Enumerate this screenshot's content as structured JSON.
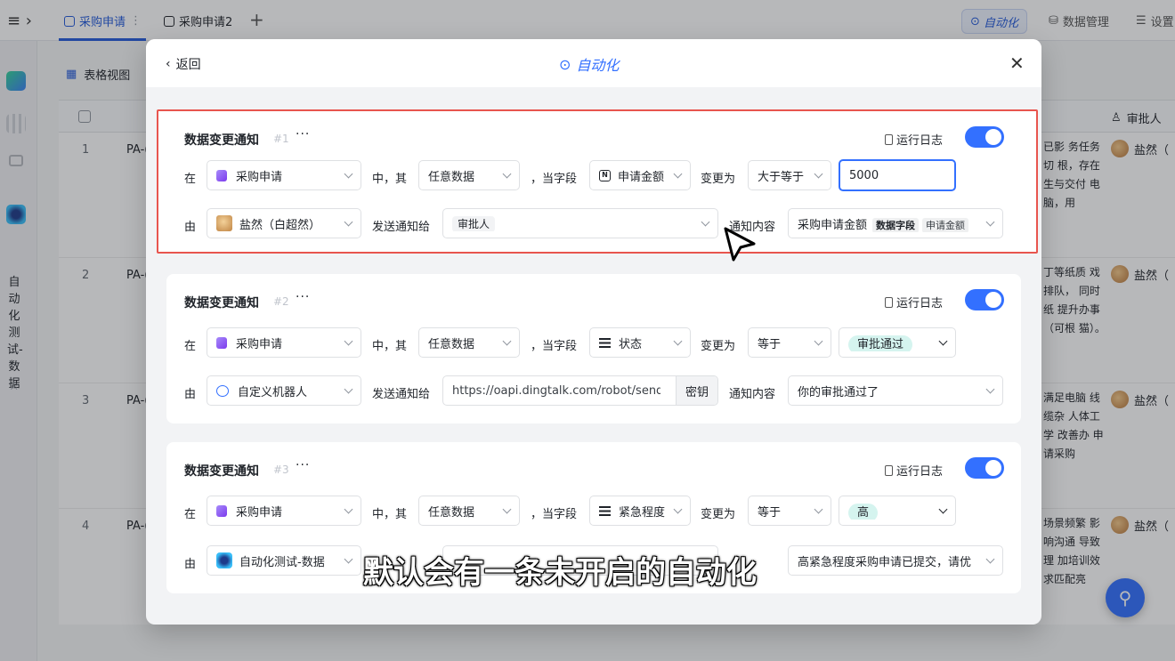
{
  "topbar": {
    "tabs": [
      {
        "label": "采购申请"
      },
      {
        "label": "采购申请2"
      }
    ],
    "automation_label": "自动化",
    "data_manage_label": "数据管理",
    "settings_label": "设置"
  },
  "sidebar": {
    "app_name": "自动化测试-数据"
  },
  "view": {
    "label": "表格视图"
  },
  "table": {
    "approver_header": "审批人",
    "rows": [
      {
        "num": "1",
        "id": "PA-(",
        "text": "已影 务任务切 根，存在 生与交付 电脑，用",
        "approver": "盐然（"
      },
      {
        "num": "2",
        "id": "PA-(",
        "text": "丁等纸质 戏排队， 同时纸 提升办事 （可根 猫）。",
        "approver": "盐然（"
      },
      {
        "num": "3",
        "id": "PA-(",
        "text": "满足电脑 线缆杂 人体工学 改善办 申请采购",
        "approver": "盐然（"
      },
      {
        "num": "4",
        "id": "PA-(",
        "text": "场景频繁 影响沟通 导致理 加培训效 求匹配亮",
        "approver": "盐然（"
      }
    ]
  },
  "modal": {
    "back_label": "返回",
    "title": "自动化",
    "rules": [
      {
        "title": "数据变更通知",
        "no": "#1",
        "more": "···",
        "log_label": "运行日志",
        "enabled": true,
        "in_label": "在",
        "table": "采购申请",
        "mid_label": "中，其",
        "scope": "任意数据",
        "field_label": "，当字段",
        "field": "申请金额",
        "change_label": "变更为",
        "operator": "大于等于",
        "value": "5000",
        "by_label": "由",
        "sender": "盐然（白超然）",
        "send_label": "发送通知给",
        "recipient": "审批人",
        "content_label": "通知内容",
        "content": "采购申请金额",
        "content_badge1": "数据字段",
        "content_badge2": "申请金额"
      },
      {
        "title": "数据变更通知",
        "no": "#2",
        "more": "···",
        "log_label": "运行日志",
        "enabled": true,
        "in_label": "在",
        "table": "采购申请",
        "mid_label": "中，其",
        "scope": "任意数据",
        "field_label": "，当字段",
        "field": "状态",
        "change_label": "变更为",
        "operator": "等于",
        "value": "审批通过",
        "by_label": "由",
        "sender": "自定义机器人",
        "send_label": "发送通知给",
        "recipient": "https://oapi.dingtalk.com/robot/send?ac",
        "secret_label": "密钥",
        "content_label": "通知内容",
        "content": "你的审批通过了"
      },
      {
        "title": "数据变更通知",
        "no": "#3",
        "more": "···",
        "log_label": "运行日志",
        "enabled": true,
        "in_label": "在",
        "table": "采购申请",
        "mid_label": "中，其",
        "scope": "任意数据",
        "field_label": "，当字段",
        "field": "紧急程度",
        "change_label": "变更为",
        "operator": "等于",
        "value": "高",
        "by_label": "由",
        "sender": "自动化测试-数据",
        "content": "高紧急程度采购申请已提交，请优"
      }
    ]
  },
  "subtitle": "默认会有一条未开启的自动化",
  "colors": {
    "accent": "#3370ff",
    "highlight_border": "#e8554e",
    "tag_green": "#d5f4ef"
  }
}
